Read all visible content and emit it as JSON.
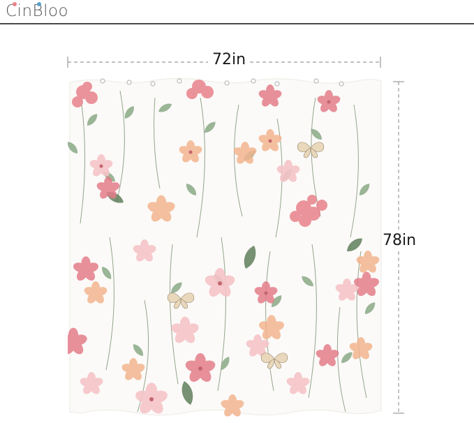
{
  "brand": {
    "name": "CinBloo"
  },
  "dimensions": {
    "width_label": "72in",
    "height_label": "78in"
  },
  "product": {
    "image_name": "floral-shower-curtain"
  },
  "colors": {
    "rule": "#4a4a4a",
    "dash": "#9a9a9a",
    "pink": "#e8808a",
    "peach": "#f2b48f",
    "blush": "#f6c4c8",
    "sage": "#8aa886",
    "deep_green": "#5f7e5b",
    "beige": "#e8d6b8"
  }
}
